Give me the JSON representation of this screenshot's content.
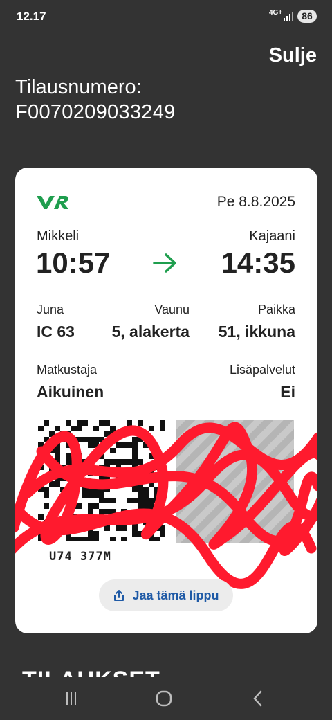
{
  "status_bar": {
    "time": "12.17",
    "network": "4G+",
    "battery": "86",
    "icons": [
      "signal-icon"
    ]
  },
  "header": {
    "close_label": "Sulje",
    "order_label": "Tilausnumero:",
    "order_number": "F0070209033249"
  },
  "ticket": {
    "brand": "VR",
    "brand_color": "#1f9e4e",
    "date": "Pe 8.8.2025",
    "from_city": "Mikkeli",
    "to_city": "Kajaani",
    "departure": "10:57",
    "arrival": "14:35",
    "train_label": "Juna",
    "train_value": "IC 63",
    "car_label": "Vaunu",
    "car_value": "5, alakerta",
    "seat_label": "Paikka",
    "seat_value": "51, ikkuna",
    "passenger_label": "Matkustaja",
    "passenger_value": "Aikuinen",
    "extras_label": "Lisäpalvelut",
    "extras_value": "Ei",
    "code_text": "U74   377M",
    "share_label": "Jaa tämä lippu"
  },
  "below": {
    "heading": "TILAUKSET"
  },
  "nav": {
    "icons": [
      "recent-apps-icon",
      "home-icon",
      "back-icon"
    ]
  }
}
